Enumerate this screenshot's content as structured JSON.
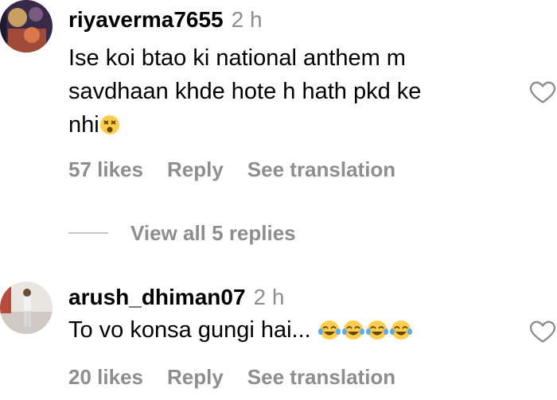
{
  "comments": [
    {
      "username": "riyaverma7655",
      "time": "2 h",
      "text_lines": [
        "Ise koi btao ki national anthem m",
        "savdhaan khde hote h hath pkd ke",
        "nhi"
      ],
      "emoji": "dizzy-face-emoji",
      "likes": "57 likes",
      "reply": "Reply",
      "translate": "See translation",
      "view_replies": "View all 5 replies"
    },
    {
      "username": "arush_dhiman07",
      "time": "2 h",
      "text": "To vo konsa gungi hai...",
      "emoji": "tears-of-joy-emoji",
      "likes": "20 likes",
      "reply": "Reply",
      "translate": "See translation"
    }
  ],
  "colors": {
    "secondary_text": "#8e8e8e",
    "divider": "#c7c7c7",
    "emoji_yellow": "#ffcc4d"
  }
}
